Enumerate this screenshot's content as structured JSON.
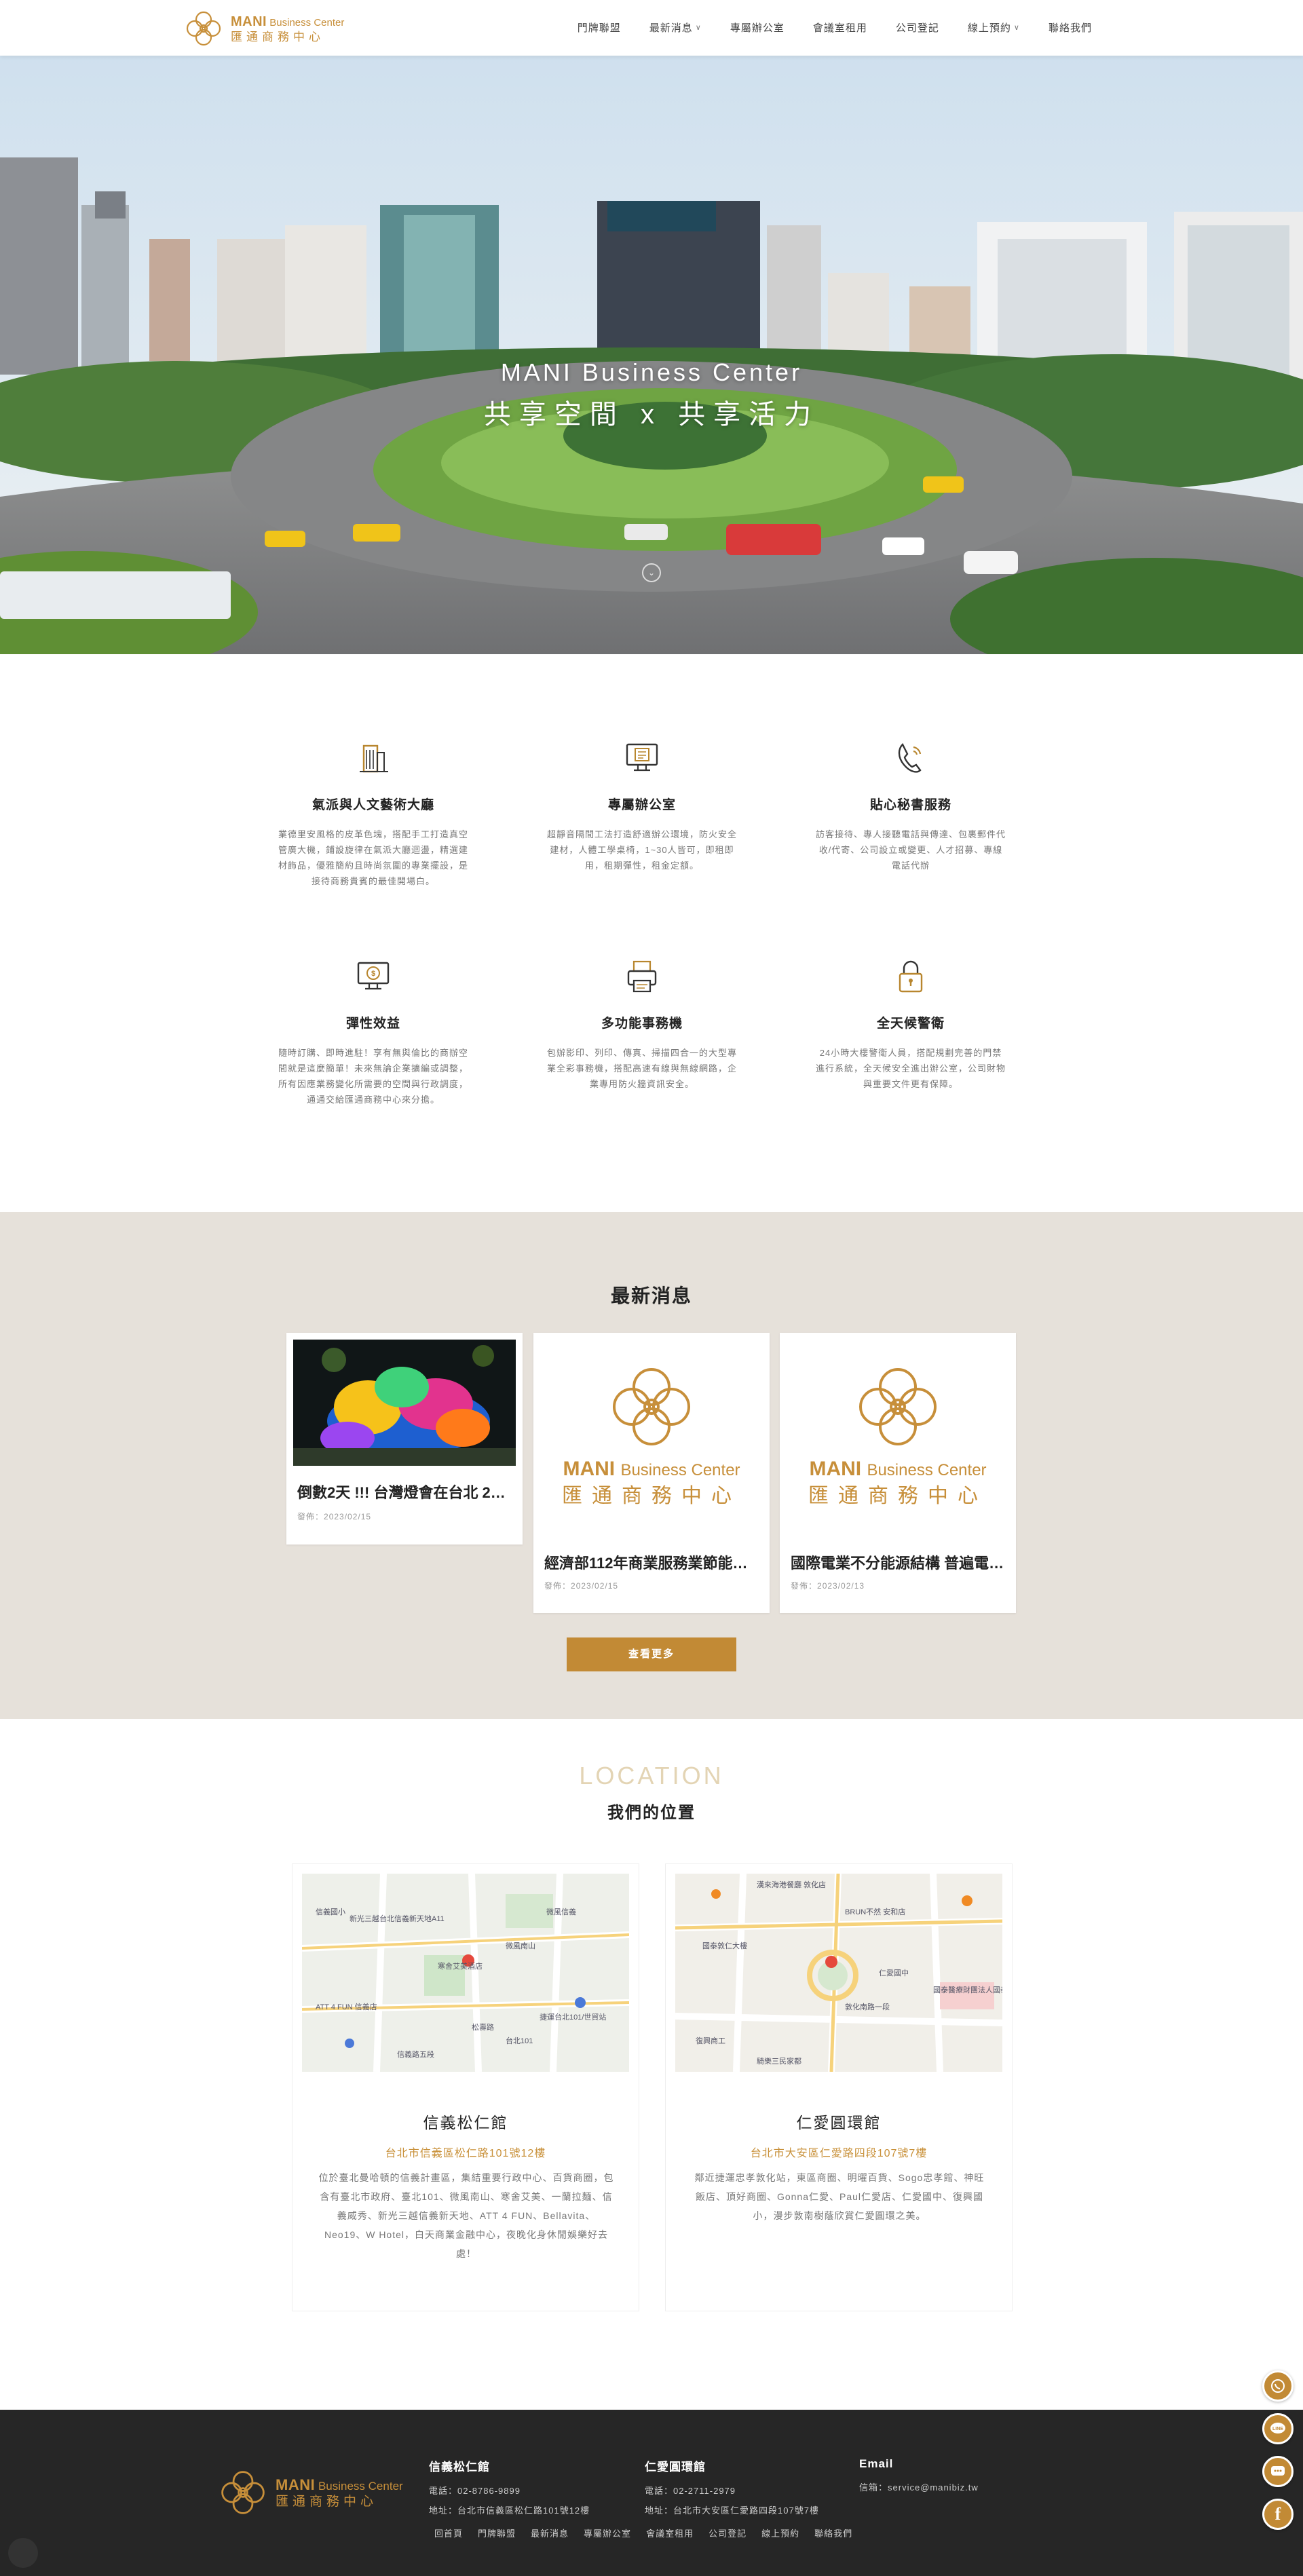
{
  "brand": {
    "name_en_bold": "MANI",
    "name_en_rest": "Business Center",
    "name_zh": "匯通商務中心",
    "accent": "#c28a35"
  },
  "nav": {
    "items": [
      {
        "label": "門牌聯盟",
        "dropdown": false
      },
      {
        "label": "最新消息",
        "dropdown": true
      },
      {
        "label": "專屬辦公室",
        "dropdown": false
      },
      {
        "label": "會議室租用",
        "dropdown": false
      },
      {
        "label": "公司登記",
        "dropdown": false
      },
      {
        "label": "線上預約",
        "dropdown": true
      },
      {
        "label": "聯絡我們",
        "dropdown": false
      }
    ]
  },
  "hero": {
    "title": "MANI Business Center",
    "subtitle": "共享空間 x 共享活力",
    "scroll_icon": "chevron-down-icon"
  },
  "features": [
    {
      "icon": "building-icon",
      "title": "氣派與人文藝術大廳",
      "text": "業德里安風格的皮革色塊，搭配手工打造真空管廣大機，鋪設旋律在氣派大廳迴盪，精選建材飾品，優雅簡約且時尚氛圍的專業擺設，是接待商務貴賓的最佳開場白。"
    },
    {
      "icon": "monitor-icon",
      "title": "專屬辦公室",
      "text": "超靜音隔間工法打造舒適辦公環境，防火安全建材，人體工學桌椅，1~30人皆可，即租即用，租期彈性，租金定額。"
    },
    {
      "icon": "phone-icon",
      "title": "貼心秘書服務",
      "text": "訪客接待、專人接聽電話與傳達、包裹郵件代收/代寄、公司設立或變更、人才招募、專線電話代辦"
    },
    {
      "icon": "money-screen-icon",
      "title": "彈性效益",
      "text": "隨時訂購、即時進駐！享有無與倫比的商辦空間就是這麼簡單！未來無論企業擴編或調整，所有因應業務變化所需要的空間與行政調度，通通交給匯通商務中心來分擔。"
    },
    {
      "icon": "printer-icon",
      "title": "多功能事務機",
      "text": "包辦影印、列印、傳真、掃描四合一的大型專業全彩事務機，搭配高速有線與無線網路，企業專用防火牆資訊安全。"
    },
    {
      "icon": "lock-icon",
      "title": "全天候警衛",
      "text": "24小時大樓警衛人員，搭配規劃完善的門禁進行系統，全天候安全進出辦公室，公司財物與重要文件更有保障。"
    }
  ],
  "news": {
    "title": "最新消息",
    "date_prefix": "發佈：",
    "items": [
      {
        "title": "倒數2天 !!! 台灣燈會在台北 2023台灣燈會",
        "date": "2023/02/15",
        "image": "lantern-photo"
      },
      {
        "title": "經濟部112年商業服務業節能補助",
        "date": "2023/02/15",
        "image": "logo-placeholder"
      },
      {
        "title": "國際電業不分能源結構 普遍電價上漲",
        "date": "2023/02/13",
        "image": "logo-placeholder"
      }
    ],
    "more_label": "查看更多"
  },
  "location": {
    "title_en": "LOCATION",
    "title_zh": "我們的位置",
    "branches": [
      {
        "name": "信義松仁館",
        "address": "台北市信義區松仁路101號12樓",
        "desc": "位於臺北曼哈頓的信義計畫區，集結重要行政中心、百貨商圈，包含有臺北市政府、臺北101、微風南山、寒舍艾美、一蘭拉麵、信義威秀、新光三越信義新天地、ATT 4 FUN、Bellavita、Neo19、W Hotel，白天商業金融中心，夜晚化身休閒娛樂好去處！",
        "map_labels": [
          "ATT 4 FUN 信義店",
          "新光三越台北信義新天地A11",
          "微風南山",
          "松壽路",
          "寒舍艾美酒店",
          "微風信義",
          "台北101",
          "信義國小",
          "捷運台北101/世貿站",
          "信義路五段"
        ]
      },
      {
        "name": "仁愛圓環館",
        "address": "台北市大安區仁愛路四段107號7樓",
        "desc": "鄰近捷運忠孝敦化站，東區商圈、明曜百貨、Sogo忠孝館、神旺飯店、頂好商圈、Gonna仁愛、Paul仁愛店、仁愛國中、復興國小，漫步敦南樹蔭欣賞仁愛圓環之美。",
        "map_labels": [
          "漢來海港餐廳 敦化店",
          "BRUN不然 安和店",
          "國泰敦仁大樓",
          "仁愛國中",
          "騎樂三民家都",
          "國泰醫療財團法人國泰綜合醫院",
          "復興商工",
          "敦化南路一段"
        ]
      }
    ]
  },
  "footer": {
    "branches": [
      {
        "name": "信義松仁館",
        "phone_label": "電話：",
        "phone": "02-8786-9899",
        "addr_label": "地址：",
        "address": "台北市信義區松仁路101號12樓"
      },
      {
        "name": "仁愛圓環館",
        "phone_label": "電話：",
        "phone": "02-2711-2979",
        "addr_label": "地址：",
        "address": "台北市大安區仁愛路四段107號7樓"
      }
    ],
    "email_title": "Email",
    "email_label": "信箱：",
    "email": "service@manibiz.tw",
    "nav": [
      "回首頁",
      "門牌聯盟",
      "最新消息",
      "專屬辦公室",
      "會議室租用",
      "公司登記",
      "線上預約",
      "聯絡我們"
    ]
  },
  "floating": [
    "whatsapp-icon",
    "line-icon",
    "chat-icon",
    "facebook-icon"
  ]
}
